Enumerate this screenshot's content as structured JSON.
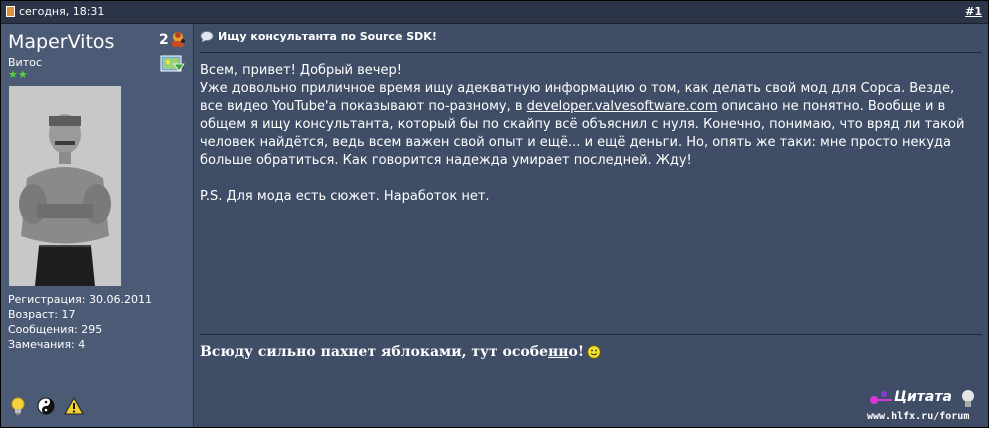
{
  "header": {
    "date": "сегодня, 18:31",
    "post_number": "#1"
  },
  "user": {
    "name": "MaperVitos",
    "title": "Витос",
    "stars": "★★",
    "stats": [
      "Регистрация: 30.06.2011",
      "Возраст: 17",
      "Сообщения: 295",
      "Замечания: 4"
    ]
  },
  "post": {
    "title": "Ищу консультанта по Source SDK!",
    "lines": [
      "Всем, привет! Добрый вечер!",
      "Уже довольно приличное время ищу адекватную информацию о том, как делать свой мод для Сорса. Везде, все видео YouTube'а показывают по-разному, в ",
      "developer.valvesoftware.com",
      " описано не понятно. Вообще и в общем я ищу консультанта, который бы по скайпу всё объяснил с нуля. Конечно, понимаю, что вряд ли такой человек найдётся, ведь всем важен свой опыт и ещё... и ещё деньги. Но, опять же таки: мне просто некуда больше обратиться. Как говорится надежда умирает последней. Жду!",
      "P.S. Для мода есть сюжет. Наработок нет."
    ],
    "signature_a": "Всюду сильно пахнет яблоками, тут особе",
    "signature_b": "нн",
    "signature_c": "о!"
  },
  "watermark": {
    "brand": "Цитата",
    "url": "www.hlfx.ru/forum"
  }
}
